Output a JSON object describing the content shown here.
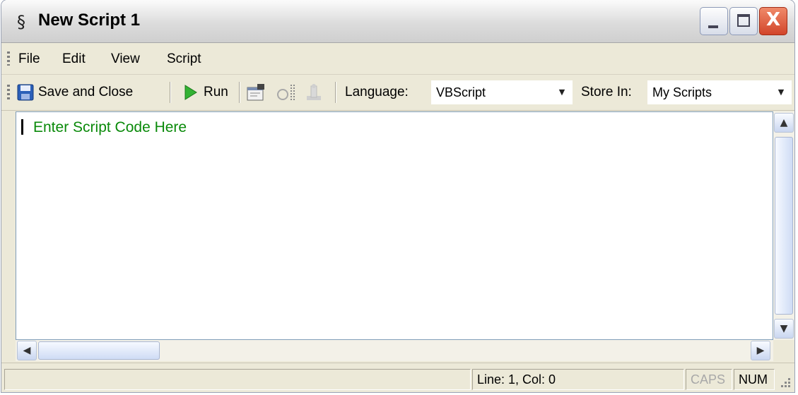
{
  "window": {
    "title": "New Script 1",
    "title_icon": "script-icon",
    "controls": {
      "minimize": "minimize",
      "maximize": "maximize",
      "close": "X"
    }
  },
  "menu": {
    "items": [
      {
        "label": "File"
      },
      {
        "label": "Edit"
      },
      {
        "label": "View"
      },
      {
        "label": "Script"
      }
    ]
  },
  "toolbar": {
    "save_close_label": "Save and Close",
    "run_label": "Run",
    "icons": [
      "save-icon",
      "run-icon",
      "properties-icon",
      "debug-icon",
      "disabled-tool-icon"
    ],
    "language_label": "Language:",
    "language_value": "VBScript",
    "store_label": "Store In:",
    "store_value": "My Scripts"
  },
  "editor": {
    "placeholder_text": "Enter Script Code Here",
    "text_color": "#0a8a0a"
  },
  "status": {
    "position": "Line: 1, Col: 0",
    "caps": "CAPS",
    "num": "NUM"
  }
}
